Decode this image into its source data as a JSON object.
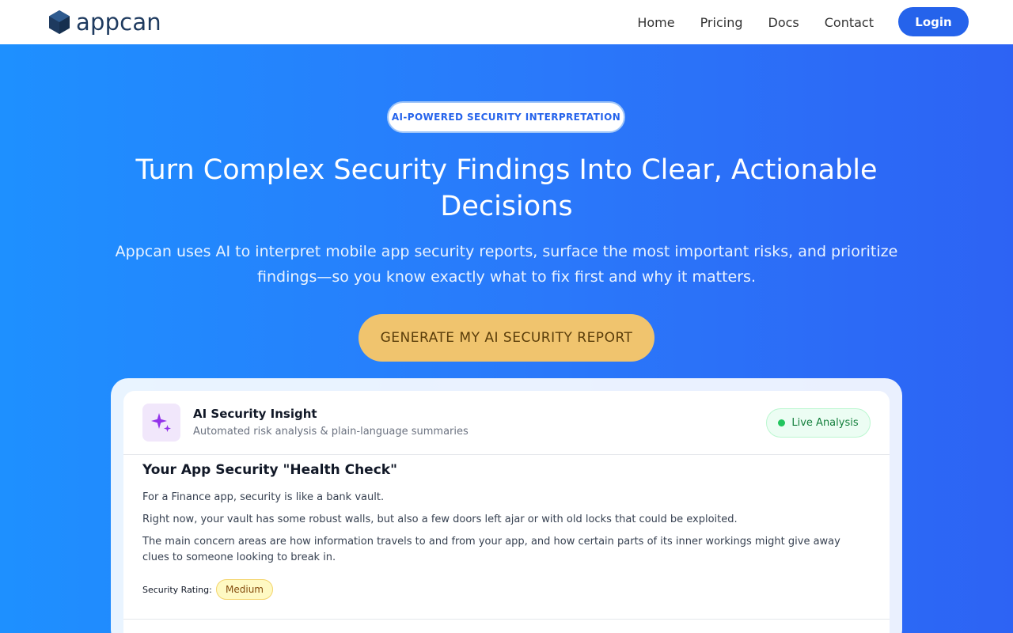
{
  "brand": {
    "name": "appcan",
    "logo_icon": "hexagon-cube-icon"
  },
  "nav": {
    "links": [
      "Home",
      "Pricing",
      "Docs",
      "Contact"
    ],
    "login_label": "Login"
  },
  "hero": {
    "badge": "AI-POWERED SECURITY INTERPRETATION",
    "title": "Turn Complex Security Findings Into Clear, Actionable Decisions",
    "subtitle": "Appcan uses AI to interpret mobile app security reports, surface the most important risks, and prioritize findings—so you know exactly what to fix first and why it matters.",
    "cta_label": "GENERATE MY AI SECURITY REPORT"
  },
  "insight": {
    "icon": "sparkles-icon",
    "title": "AI Security Insight",
    "subtitle": "Automated risk analysis & plain-language summaries",
    "status_label": "Live Analysis",
    "health_title": "Your App Security \"Health Check\"",
    "paragraphs": [
      "For a Finance app, security is like a bank vault.",
      "Right now, your vault has some robust walls, but also a few doors left ajar or with old locks that could be exploited.",
      "The main concern areas are how information travels to and from your app, and how certain parts of its inner workings might give away clues to someone looking to break in."
    ],
    "rating_label": "Security Rating:",
    "rating_value": "Medium"
  },
  "colors": {
    "primary": "#2563eb",
    "cta": "#f0c46e",
    "hero_gradient_start": "#1e90ff",
    "hero_gradient_end": "#2d63f4",
    "live_green": "#22c55e",
    "rating_yellow": "#fef9c3"
  }
}
